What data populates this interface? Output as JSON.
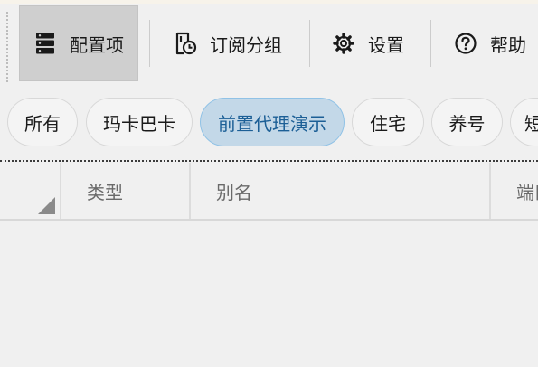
{
  "toolbar": {
    "config": {
      "label": "配置项",
      "icon": "server-stack-icon"
    },
    "subscription_groups": {
      "label": "订阅分组",
      "icon": "subscription-clock-icon"
    },
    "settings": {
      "label": "设置",
      "icon": "gear-icon"
    },
    "help": {
      "label": "帮助",
      "icon": "question-circle-icon"
    }
  },
  "groups": {
    "selected": "前置代理演示",
    "items": [
      "所有",
      "玛卡巴卡",
      "前置代理演示",
      "住宅",
      "养号",
      "短"
    ]
  },
  "table": {
    "columns": [
      "类型",
      "别名",
      "端口"
    ]
  },
  "colors": {
    "selected_chip_bg": "#c3d8e8",
    "selected_chip_text": "#1c5f96",
    "active_toolbar_bg": "#cfcfcf"
  }
}
